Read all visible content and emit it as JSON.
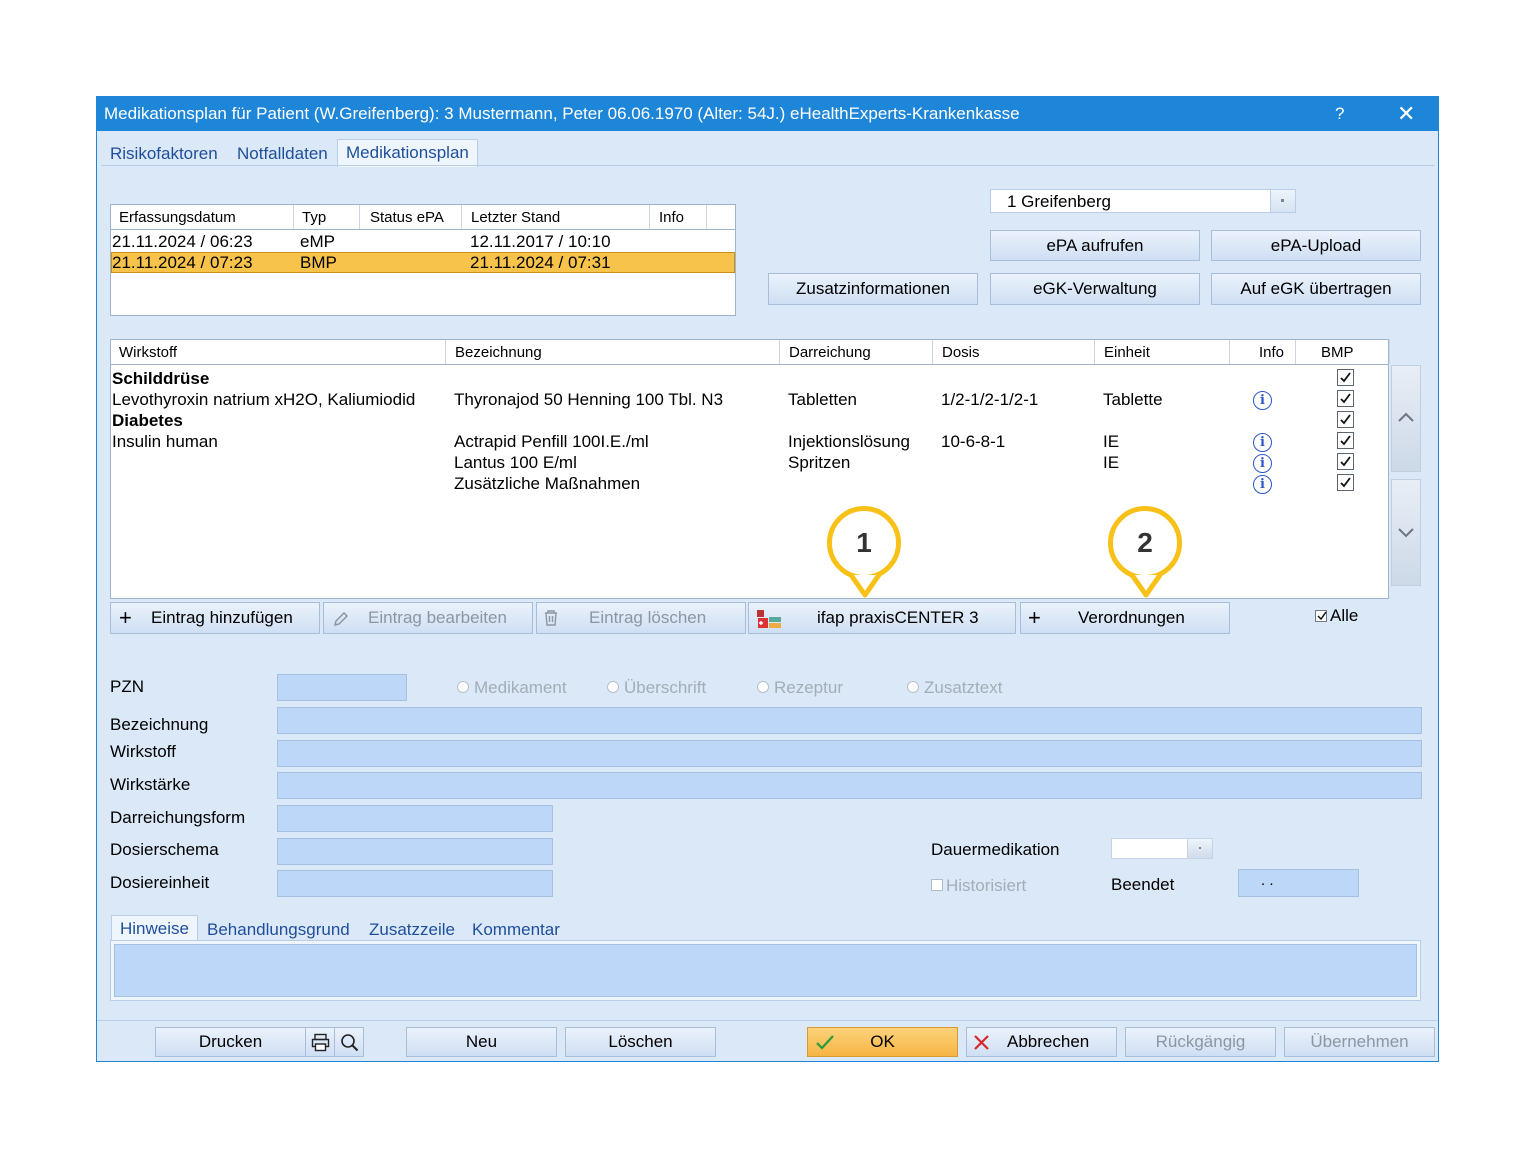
{
  "window": {
    "title": "Medikationsplan für Patient (W.Greifenberg): 3  Mustermann, Peter 06.06.1970  (Alter: 54J.)  eHealthExperts-Krankenkasse",
    "help": "?",
    "close": "✕"
  },
  "tabs": [
    "Risikofaktoren",
    "Notfalldaten",
    "Medikationsplan"
  ],
  "user_select": {
    "value": "1 Greifenberg"
  },
  "plan_table": {
    "headers": [
      "Erfassungsdatum",
      "Typ",
      "Status ePA",
      "Letzter Stand",
      "Info"
    ],
    "rows": [
      {
        "date": "21.11.2024 / 06:23",
        "typ": "eMP",
        "status": "",
        "stand": "12.11.2017 / 10:10",
        "info": ""
      },
      {
        "date": "21.11.2024 / 07:23",
        "typ": "BMP",
        "status": "",
        "stand": "21.11.2024 / 07:31",
        "info": ""
      }
    ]
  },
  "top_buttons": {
    "epa_aufrufen": "ePA aufrufen",
    "epa_upload": "ePA-Upload",
    "zusatzinfo": "Zusatzinformationen",
    "egk_verwaltung": "eGK-Verwaltung",
    "auf_egk": "Auf eGK übertragen"
  },
  "med_table": {
    "headers": [
      "Wirkstoff",
      "Bezeichnung",
      "Darreichung",
      "Dosis",
      "Einheit",
      "Info",
      "BMP"
    ],
    "rows": [
      {
        "wirkstoff": "Schilddrüse",
        "bezeichnung": "",
        "darreichung": "",
        "dosis": "",
        "einheit": "",
        "heading": true
      },
      {
        "wirkstoff": "Levothyroxin natrium xH2O, Kaliumiodid",
        "bezeichnung": "Thyronajod 50 Henning 100 Tbl. N3",
        "darreichung": "Tabletten",
        "dosis": "1/2-1/2-1/2-1",
        "einheit": "Tablette",
        "heading": false
      },
      {
        "wirkstoff": "Diabetes",
        "bezeichnung": "",
        "darreichung": "",
        "dosis": "",
        "einheit": "",
        "heading": true
      },
      {
        "wirkstoff": "Insulin human",
        "bezeichnung": "Actrapid Penfill 100I.E./ml",
        "darreichung": "Injektionslösung",
        "dosis": "10-6-8-1",
        "einheit": "IE",
        "heading": false
      },
      {
        "wirkstoff": "",
        "bezeichnung": "Lantus 100 E/ml",
        "darreichung": "Spritzen",
        "dosis": "",
        "einheit": "IE",
        "heading": false
      },
      {
        "wirkstoff": "",
        "bezeichnung": "Zusätzliche Maßnahmen",
        "darreichung": "",
        "dosis": "",
        "einheit": "",
        "heading": false
      }
    ]
  },
  "callouts": [
    "1",
    "2"
  ],
  "action_buttons": {
    "add": "Eintrag hinzufügen",
    "edit": "Eintrag bearbeiten",
    "delete": "Eintrag löschen",
    "ifap": "ifap praxisCENTER 3",
    "verordnungen": "Verordnungen",
    "alle": "Alle"
  },
  "form": {
    "pzn": "PZN",
    "radio_options": [
      "Medikament",
      "Überschrift",
      "Rezeptur",
      "Zusatztext"
    ],
    "bezeichnung": "Bezeichnung",
    "wirkstoff": "Wirkstoff",
    "wirkstaerke": "Wirkstärke",
    "darreichungsform": "Darreichungsform",
    "dosierschema": "Dosierschema",
    "dosiereinheit": "Dosiereinheit",
    "dauermedikation": "Dauermedikation",
    "historisiert": "Historisiert",
    "beendet": "Beendet",
    "beendet_value": ".   ."
  },
  "sub_tabs": [
    "Hinweise",
    "Behandlungsgrund",
    "Zusatzzeile",
    "Kommentar"
  ],
  "footer": {
    "drucken": "Drucken",
    "neu": "Neu",
    "loeschen": "Löschen",
    "ok": "OK",
    "abbrechen": "Abbrechen",
    "rueckgaengig": "Rückgängig",
    "uebernehmen": "Übernehmen"
  },
  "colors": {
    "title_bar": "#1e86d8",
    "selected_row": "#f8c34a",
    "ok_button": "#f7b545",
    "callout": "#f8c118",
    "field": "#bdd7f8"
  }
}
